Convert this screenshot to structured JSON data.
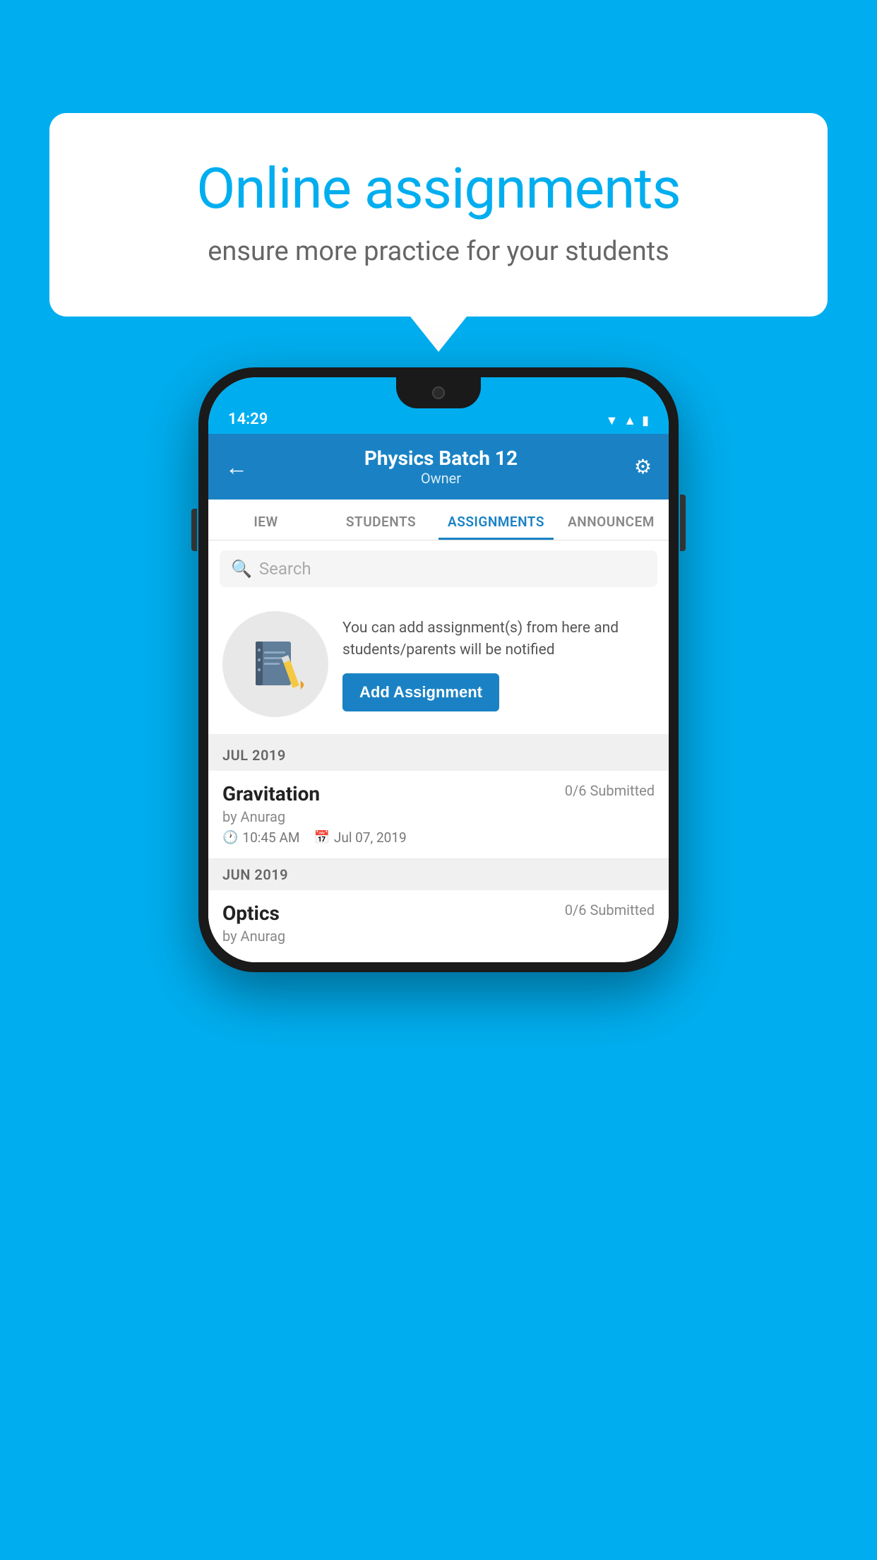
{
  "background": {
    "color": "#00AEEF"
  },
  "speech_bubble": {
    "title": "Online assignments",
    "subtitle": "ensure more practice for your students"
  },
  "status_bar": {
    "time": "14:29",
    "icons": [
      "wifi",
      "signal",
      "battery"
    ]
  },
  "app_bar": {
    "back_icon": "←",
    "title": "Physics Batch 12",
    "subtitle": "Owner",
    "settings_icon": "⚙"
  },
  "tabs": [
    {
      "label": "IEW",
      "active": false
    },
    {
      "label": "STUDENTS",
      "active": false
    },
    {
      "label": "ASSIGNMENTS",
      "active": true
    },
    {
      "label": "ANNOUNCEM",
      "active": false
    }
  ],
  "search": {
    "placeholder": "Search"
  },
  "promo": {
    "description": "You can add assignment(s) from here and students/parents will be notified",
    "button_label": "Add Assignment"
  },
  "sections": [
    {
      "header": "JUL 2019",
      "assignments": [
        {
          "name": "Gravitation",
          "submitted": "0/6 Submitted",
          "author": "by Anurag",
          "time": "10:45 AM",
          "date": "Jul 07, 2019"
        }
      ]
    },
    {
      "header": "JUN 2019",
      "assignments": [
        {
          "name": "Optics",
          "submitted": "0/6 Submitted",
          "author": "by Anurag",
          "time": "",
          "date": ""
        }
      ]
    }
  ]
}
